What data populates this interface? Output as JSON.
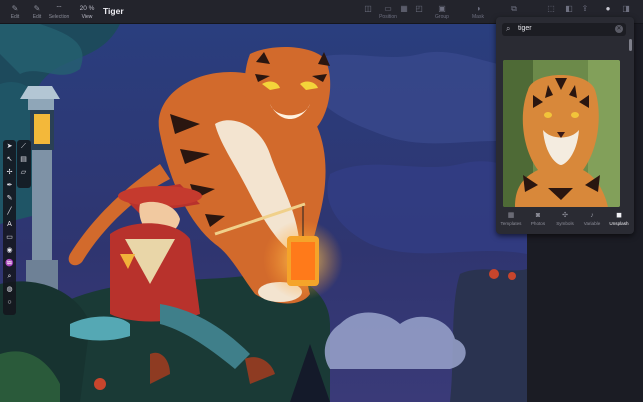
{
  "toolbar": {
    "btn1_label": "Edit",
    "btn2_label": "Edit",
    "btn3_label": "Selection",
    "view_label": "View",
    "zoom_value": "20 %",
    "doc_title": "Tiger",
    "right_labels": [
      "Position",
      "Group",
      "Mask"
    ]
  },
  "panel": {
    "search_value": "tiger",
    "tabs": [
      "Templates",
      "Photos",
      "Symbols",
      "Variable",
      "Unsplash"
    ],
    "active_tab": "Unsplash"
  },
  "colors": {
    "night_sky": "#2f3570",
    "tiger_orange": "#d26a2c",
    "cliff": "#1a3a36",
    "lantern": "#f5b32d",
    "panel_bg": "#2a2b33"
  },
  "icons": {
    "tools": [
      "pointer-icon",
      "direct-select-icon",
      "node-icon",
      "pen-icon",
      "pencil-icon",
      "brush-icon",
      "knife-icon",
      "text-icon",
      "rectangle-icon",
      "fill-icon",
      "eyedropper-icon",
      "zoom-icon",
      "color-wheel-icon",
      "stroke-icon"
    ]
  }
}
